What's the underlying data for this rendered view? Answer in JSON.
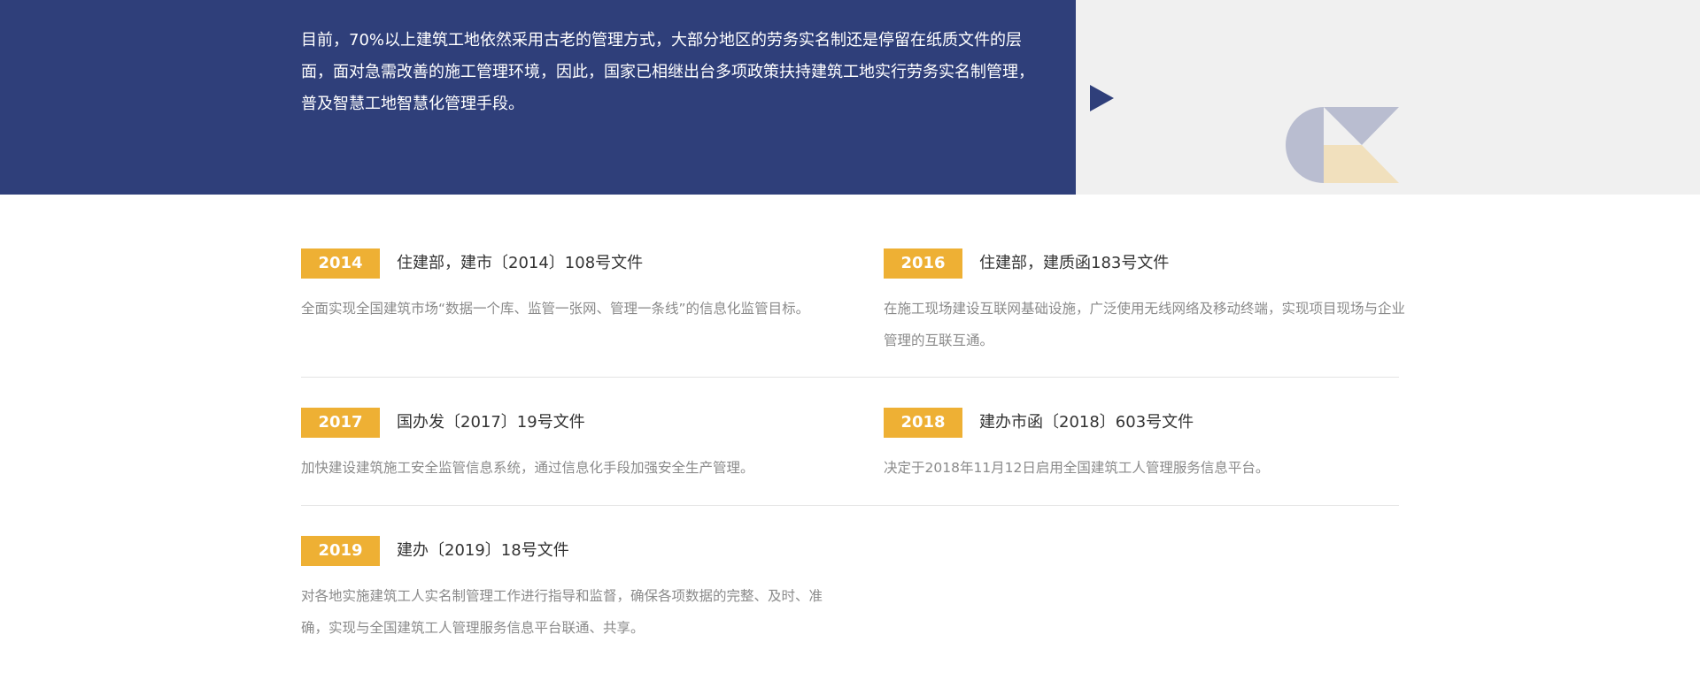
{
  "banner": {
    "text": "目前，70%以上建筑工地依然采用古老的管理方式，大部分地区的劳务实名制还是停留在纸质文件的层面，面对急需改善的施工管理环境，因此，国家已相继出台多项政策扶持建筑工地实行劳务实名制管理，普及智慧工地智慧化管理手段。"
  },
  "colors": {
    "banner_blue": "#2f3f7a",
    "banner_gray": "#f0f0f0",
    "badge_yellow": "#eeb034",
    "logo_gray": "#b9bdd0",
    "logo_cream": "#f1e0bd"
  },
  "policies": [
    {
      "year": "2014",
      "title": "住建部，建市〔2014〕108号文件",
      "description": "全面实现全国建筑市场“数据一个库、监管一张网、管理一条线”的信息化监管目标。"
    },
    {
      "year": "2016",
      "title": "住建部，建质函183号文件",
      "description": "在施工现场建设互联网基础设施，广泛使用无线网络及移动终端，实现项目现场与企业管理的互联互通。"
    },
    {
      "year": "2017",
      "title": "国办发〔2017〕19号文件",
      "description": "加快建设建筑施工安全监管信息系统，通过信息化手段加强安全生产管理。"
    },
    {
      "year": "2018",
      "title": "建办市函〔2018〕603号文件",
      "description": "决定于2018年11月12日启用全国建筑工人管理服务信息平台。"
    },
    {
      "year": "2019",
      "title": "建办〔2019〕18号文件",
      "description": "对各地实施建筑工人实名制管理工作进行指导和监督，确保各项数据的完整、及时、准确，实现与全国建筑工人管理服务信息平台联通、共享。"
    }
  ]
}
